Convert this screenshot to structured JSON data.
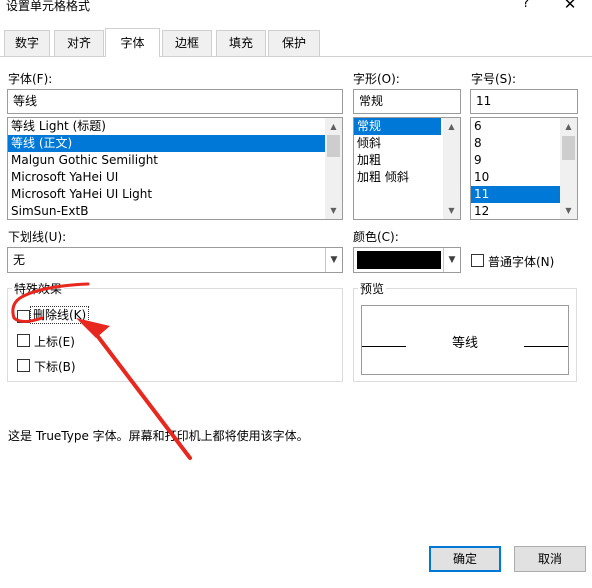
{
  "window": {
    "title": "设置单元格格式",
    "help": "?",
    "close": "✕"
  },
  "tabs": [
    {
      "label": "数字"
    },
    {
      "label": "对齐"
    },
    {
      "label": "字体",
      "active": true
    },
    {
      "label": "边框"
    },
    {
      "label": "填充"
    },
    {
      "label": "保护"
    }
  ],
  "font": {
    "label": "字体(F):",
    "value": "等线",
    "items": [
      "等线 Light (标题)",
      "等线 (正文)",
      "Malgun Gothic Semilight",
      "Microsoft YaHei UI",
      "Microsoft YaHei UI Light",
      "SimSun-ExtB"
    ],
    "selected_index": 1
  },
  "style": {
    "label": "字形(O):",
    "value": "常规",
    "items": [
      "常规",
      "倾斜",
      "加粗",
      "加粗 倾斜"
    ],
    "selected_index": 0
  },
  "size": {
    "label": "字号(S):",
    "value": "11",
    "items": [
      "6",
      "8",
      "9",
      "10",
      "11",
      "12"
    ],
    "selected_index": 4
  },
  "underline": {
    "label": "下划线(U):",
    "value": "无"
  },
  "color": {
    "label": "颜色(C):",
    "swatch": "#000000"
  },
  "normal_font": {
    "label": "普通字体(N)",
    "checked": false
  },
  "effects": {
    "label": "特殊效果",
    "strikethrough": "删除线(K)",
    "superscript": "上标(E)",
    "subscript": "下标(B)"
  },
  "preview": {
    "label": "预览",
    "text": "等线"
  },
  "info": "这是 TrueType 字体。屏幕和打印机上都将使用该字体。",
  "buttons": {
    "ok": "确定",
    "cancel": "取消"
  },
  "accents": {
    "selection": "#0078d7",
    "annotation": "#e8281e"
  }
}
